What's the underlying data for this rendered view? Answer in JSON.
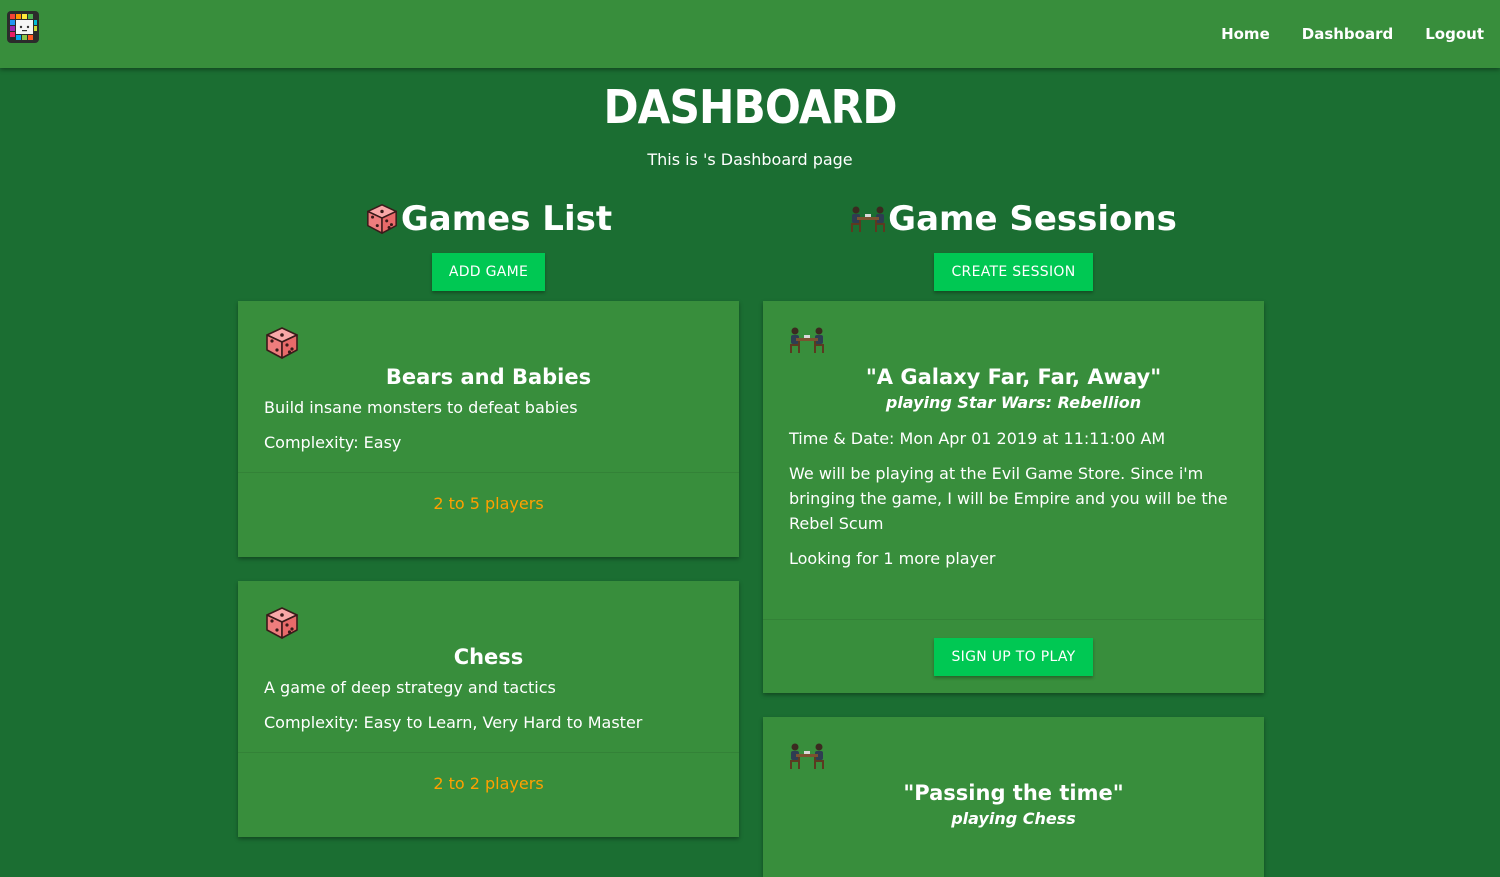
{
  "nav": {
    "links": [
      {
        "label": "Home"
      },
      {
        "label": "Dashboard"
      },
      {
        "label": "Logout"
      }
    ]
  },
  "page": {
    "title": "DASHBOARD",
    "subtitle": "This is 's Dashboard page"
  },
  "games": {
    "heading": "Games List",
    "add_button": "ADD GAME",
    "items": [
      {
        "name": "Bears and Babies",
        "description": "Build insane monsters to defeat babies",
        "complexity": "Complexity: Easy",
        "players": "2 to 5 players"
      },
      {
        "name": "Chess",
        "description": "A game of deep strategy and tactics",
        "complexity": "Complexity: Easy to Learn, Very Hard to Master",
        "players": "2 to 2 players"
      }
    ]
  },
  "sessions": {
    "heading": "Game Sessions",
    "create_button": "CREATE SESSION",
    "items": [
      {
        "title": "\"A Galaxy Far, Far, Away\"",
        "game": "playing Star Wars: Rebellion",
        "datetime": "Time & Date: Mon Apr 01 2019 at 11:11:00 AM",
        "description": "We will be playing at the Evil Game Store. Since i'm bringing the game, I will be Empire and you will be the Rebel Scum",
        "looking": "Looking for 1 more player",
        "signup_button": "SIGN UP TO PLAY"
      },
      {
        "title": "\"Passing the time\"",
        "game": "playing Chess"
      }
    ]
  },
  "colors": {
    "page_bg": "#1b6e32",
    "nav_bg": "#388e3c",
    "card_bg": "#388e3c",
    "button": "#00c853",
    "players_text": "#ffa000",
    "die": "#f48a8a"
  },
  "icons": {
    "logo": "grid-logo-icon",
    "game": "dice-icon",
    "session": "people-at-table-icon"
  }
}
